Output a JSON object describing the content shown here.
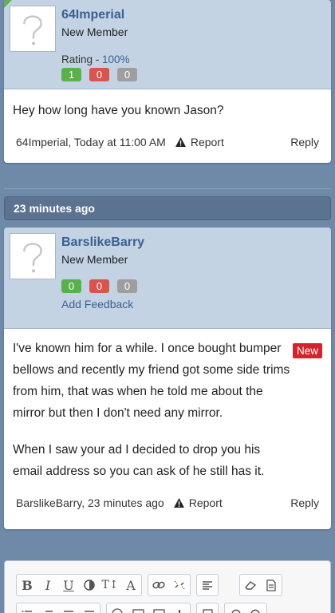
{
  "posts": [
    {
      "username": "64Imperial",
      "user_title": "New Member",
      "rating_label": "Rating - ",
      "rating_pct": "100%",
      "counts": {
        "positive": "1",
        "negative": "0",
        "neutral": "0"
      },
      "message": "Hey how long have you known Jason?",
      "meta_author_time": "64Imperial, Today at 11:00 AM",
      "report_label": "Report",
      "reply_label": "Reply"
    },
    {
      "username": "BarslikeBarry",
      "user_title": "New Member",
      "counts": {
        "positive": "0",
        "negative": "0",
        "neutral": "0"
      },
      "add_feedback_label": "Add Feedback",
      "new_badge": "New",
      "message_paragraphs": [
        "I've known him for a while. I once bought bumper bellows and recently my friend got some side trims from him, that was when he told me about the mirror but then I don't need any mirror.",
        "When I saw your ad I decided to drop you his email address so you can ask of he still has it."
      ],
      "meta_author_time": "BarslikeBarry, 23 minutes ago",
      "report_label": "Report",
      "reply_label": "Reply"
    }
  ],
  "time_separator": "23 minutes ago",
  "editor": {
    "toolbar_row1": [
      "bold-icon",
      "italic-icon",
      "underline-icon",
      "color-icon",
      "text-size-icon",
      "font-icon",
      "link-icon",
      "unlink-icon",
      "align-icon",
      "eraser-icon",
      "template-icon"
    ],
    "toolbar_row1_glyphs": {
      "bold": "B",
      "italic": "I",
      "underline": "U",
      "text_size": "T↕",
      "font": "A"
    },
    "toolbar_row2": [
      "bullet-list-icon",
      "numbered-list-icon",
      "outdent-icon",
      "indent-icon",
      "smilie-icon",
      "image-icon",
      "media-icon",
      "insert-icon",
      "save-icon",
      "undo-icon",
      "redo-icon"
    ]
  },
  "colors": {
    "background": "#6f8aa8",
    "user_block": "#c3d3e4",
    "username": "#3a5f8f",
    "positive": "#5ab14a",
    "negative": "#d9534f",
    "neutral": "#9e9e9e",
    "new_badge": "#d4232b",
    "time_bar": "#5b7391"
  }
}
